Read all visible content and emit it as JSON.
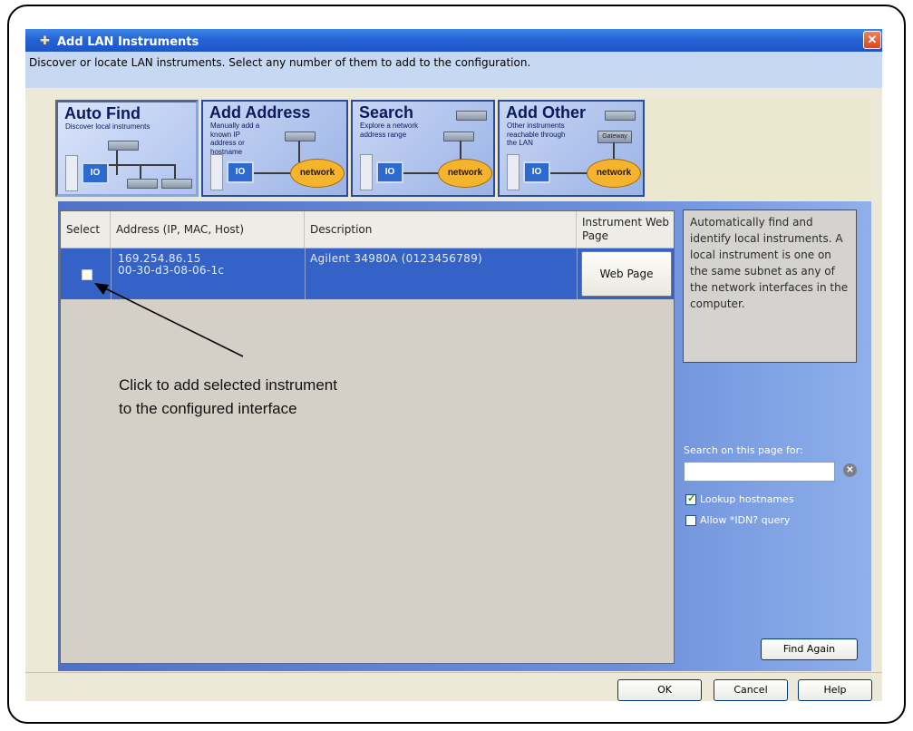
{
  "window": {
    "title": "Add LAN Instruments",
    "close_label": "✕",
    "subtitle": "Discover or locate LAN instruments. Select any number of them to add to the configuration."
  },
  "nav_tabs": [
    {
      "title": "Auto Find",
      "subtitle": "Discover local instruments",
      "active": true
    },
    {
      "title": "Add Address",
      "subtitle": "Manually add a known IP address or hostname",
      "active": false,
      "cloud_label": "network"
    },
    {
      "title": "Search",
      "subtitle": "Explore a network address range",
      "active": false,
      "cloud_label": "network"
    },
    {
      "title": "Add Other",
      "subtitle": "Other instruments reachable through the LAN",
      "active": false,
      "cloud_label": "network",
      "gateway_label": "Gateway"
    }
  ],
  "monitor_label": "IO",
  "table": {
    "columns": [
      "Select",
      "Address (IP, MAC, Host)",
      "Description",
      "Instrument Web Page"
    ],
    "rows": [
      {
        "address_ip": "169.254.86.15",
        "address_mac": "00-30-d3-08-06-1c",
        "description": "Agilent 34980A (0123456789)",
        "web_page_label": "Web Page",
        "selected": false
      }
    ]
  },
  "annotation": {
    "line1": "Click to add selected instrument",
    "line2": "to the configured interface"
  },
  "help_text": "Automatically find and identify local instruments. A local instrument is one on the same subnet as any of the network interfaces in the computer.",
  "search": {
    "label": "Search on this page for:",
    "value": "",
    "placeholder": ""
  },
  "options": {
    "lookup_hostnames": {
      "label": "Lookup hostnames",
      "checked": true
    },
    "allow_idn": {
      "label": "Allow *IDN? query",
      "checked": false
    }
  },
  "buttons": {
    "find_again": "Find Again",
    "ok": "OK",
    "cancel": "Cancel",
    "help": "Help"
  },
  "colors": {
    "title_bar": "#2564d6",
    "selected_row": "#3562c7",
    "content_bg": "#6d8fdb"
  }
}
